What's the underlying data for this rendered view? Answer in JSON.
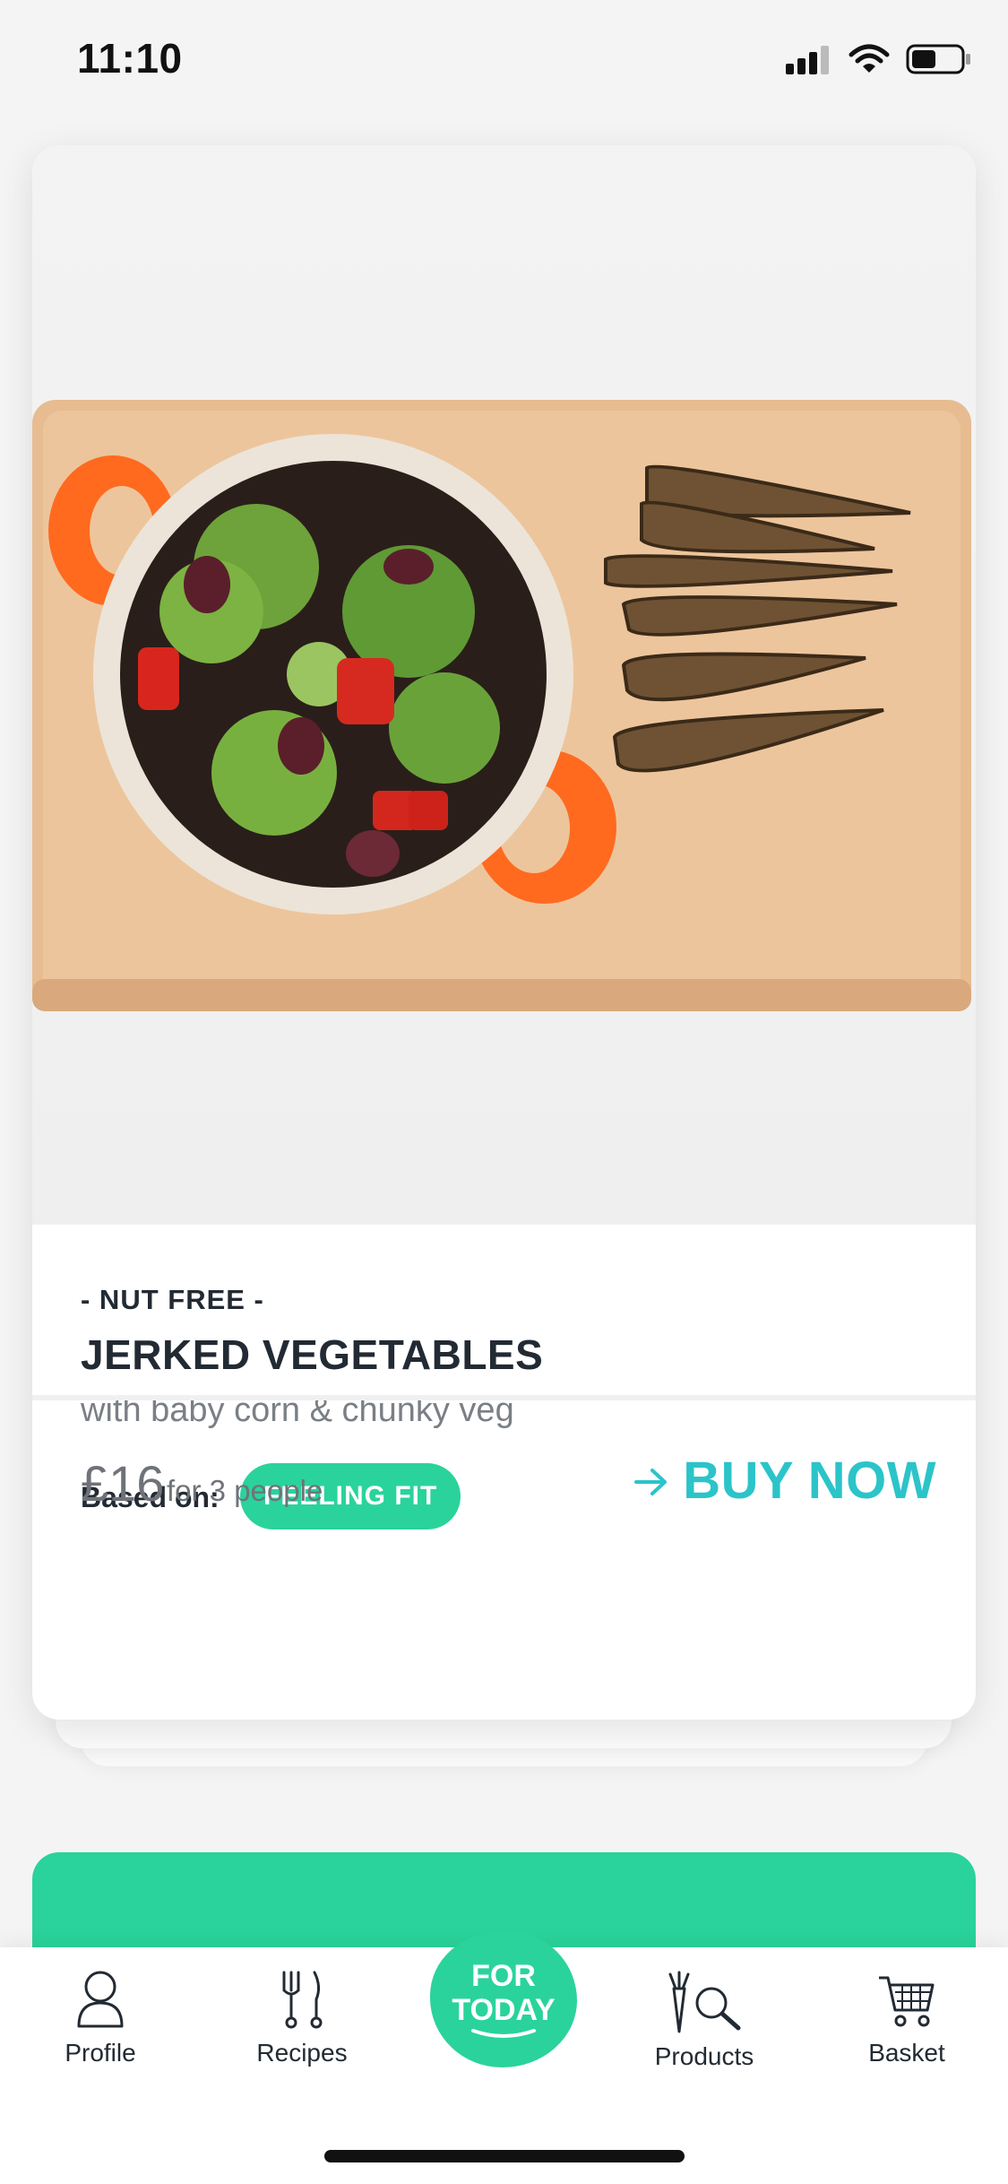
{
  "status_bar": {
    "time": "11:10"
  },
  "recipe": {
    "diet_tag": "- NUT FREE -",
    "title": "JERKED VEGETABLES",
    "subtitle": "with baby corn & chunky veg",
    "based_on_label": "Based on:",
    "mood_tag": "FEELING FIT",
    "price": "£16",
    "price_note": "for 3 people",
    "buy_label": "BUY NOW"
  },
  "nav": {
    "profile": "Profile",
    "recipes": "Recipes",
    "for_today_line1": "FOR",
    "for_today_line2": "TODAY",
    "products": "Products",
    "basket": "Basket"
  },
  "colors": {
    "accent_green": "#2ad39b",
    "accent_teal": "#2bc4c9",
    "text_dark": "#222a33"
  },
  "icons": [
    "signal-icon",
    "wifi-icon",
    "battery-icon",
    "arrow-right-icon",
    "profile-icon",
    "recipes-icon",
    "products-icon",
    "basket-icon"
  ]
}
